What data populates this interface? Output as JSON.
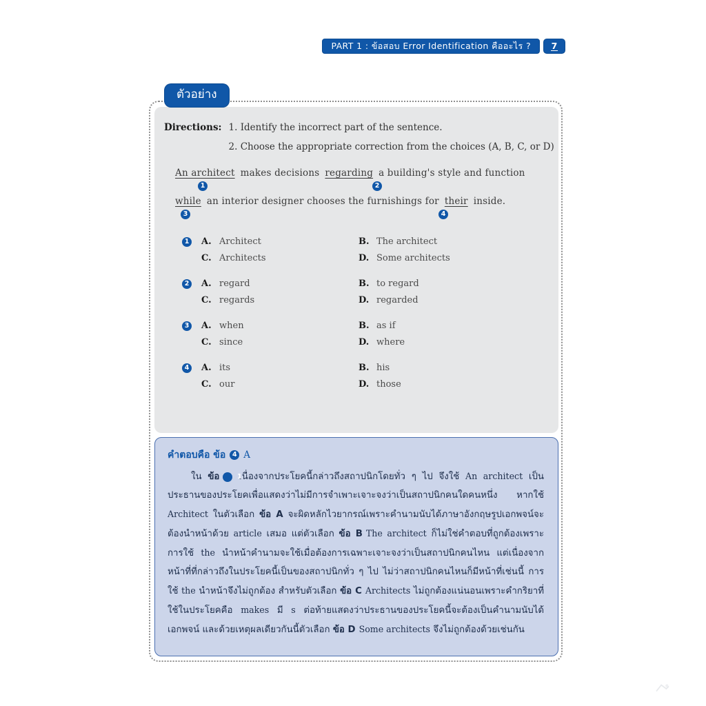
{
  "header": {
    "bar_text": "PART 1 : ข้อสอบ Error Identification คืออะไร ?",
    "page_number": "7"
  },
  "example_tab": {
    "label": "ตัวอย่าง"
  },
  "question_panel": {
    "directions_label": "Directions:",
    "directions": [
      "1. Identify the incorrect part of the sentence.",
      "2. Choose the appropriate correction from the choices (A, B, C, or D)"
    ],
    "sentence_line1": {
      "seg1_underlined": "An architect",
      "seg2_plain": "makes decisions",
      "seg3_underlined": "regarding",
      "seg4_plain": "a building's style and function",
      "marker1": "1",
      "marker2": "2"
    },
    "sentence_line2": {
      "seg1_underlined": "while",
      "seg2_plain": "an interior designer chooses the furnishings for",
      "seg3_underlined": "their",
      "seg4_plain": "inside.",
      "marker3": "3",
      "marker4": "4"
    },
    "choice_groups": [
      {
        "number": "1",
        "options": [
          {
            "letter": "A.",
            "text": "Architect"
          },
          {
            "letter": "B.",
            "text": "The architect"
          },
          {
            "letter": "C.",
            "text": "Architects"
          },
          {
            "letter": "D.",
            "text": "Some architects"
          }
        ]
      },
      {
        "number": "2",
        "options": [
          {
            "letter": "A.",
            "text": "regard"
          },
          {
            "letter": "B.",
            "text": "to regard"
          },
          {
            "letter": "C.",
            "text": "regards"
          },
          {
            "letter": "D.",
            "text": "regarded"
          }
        ]
      },
      {
        "number": "3",
        "options": [
          {
            "letter": "A.",
            "text": "when"
          },
          {
            "letter": "B.",
            "text": "as if"
          },
          {
            "letter": "C.",
            "text": "since"
          },
          {
            "letter": "D.",
            "text": "where"
          }
        ]
      },
      {
        "number": "4",
        "options": [
          {
            "letter": "A.",
            "text": "its"
          },
          {
            "letter": "B.",
            "text": "his"
          },
          {
            "letter": "C.",
            "text": "our"
          },
          {
            "letter": "D.",
            "text": "those"
          }
        ]
      }
    ]
  },
  "answer_panel": {
    "heading_prefix": "คำตอบคือ ข้อ",
    "heading_number": "4",
    "heading_letter": "A",
    "explanation": {
      "p1_a": "ใน ",
      "p1_kho": "ข้อ",
      "p1_num": "1",
      "p1_b": " เนื่องจากประโยคนี้กล่าวถึงสถาปนิกโดยทั่ว ๆ ไป จึงใช้ ",
      "p1_en1": "An architect",
      "p1_c": " เป็นประธานของประโยคเพื่อแสดงว่าไม่มีการจำเพาะเจาะจงว่าเป็นสถาปนิกคนใดคนหนึ่ง หากใช้ ",
      "p1_en2": "Architect",
      "p1_d": " ในตัวเลือก ",
      "p1_choiceA": "ข้อ A",
      "p1_e": " จะผิดหลักไวยากรณ์เพราะคำนามนับได้ภาษาอังกฤษรูปเอกพจน์จะต้องนำหน้าด้วย ",
      "p1_en3": "article",
      "p1_f": " เสมอ แต่ตัวเลือก ",
      "p1_choiceB": "ข้อ B",
      "p1_en4": "The architect",
      "p1_g": " ก็ไม่ใช่คำตอบที่ถูกต้องเพราะการใช้ ",
      "p1_en5": "the",
      "p1_h": " นำหน้าคำนามจะใช้เมื่อต้องการเฉพาะเจาะจงว่าเป็นสถาปนิกคนไหน แต่เนื่องจากหน้าที่ที่กล่าวถึงในประโยคนี้เป็นของสถาปนิกทั่ว ๆ ไป ไม่ว่าสถาปนิกคนไหนก็มีหน้าที่เช่นนี้ การใช้ ",
      "p1_en6": "the",
      "p1_i": " นำหน้าจึงไม่ถูกต้อง สำหรับตัวเลือก ",
      "p1_choiceC": "ข้อ C",
      "p1_en7": "Architects",
      "p1_j": " ไม่ถูกต้องแน่นอนเพราะคำกริยาที่ใช้ในประโยคคือ ",
      "p1_en8": "makes",
      "p1_k": " มี ",
      "p1_en9": "s",
      "p1_l": " ต่อท้ายแสดงว่าประธานของประโยคนี้จะต้องเป็นคำนามนับได้เอกพจน์ และด้วยเหตุผลเดียวกันนี้ตัวเลือก ",
      "p1_choiceD": "ข้อ D",
      "p1_en10": "Some architects",
      "p1_m": " จึงไม่ถูกต้องด้วยเช่นกัน"
    }
  }
}
